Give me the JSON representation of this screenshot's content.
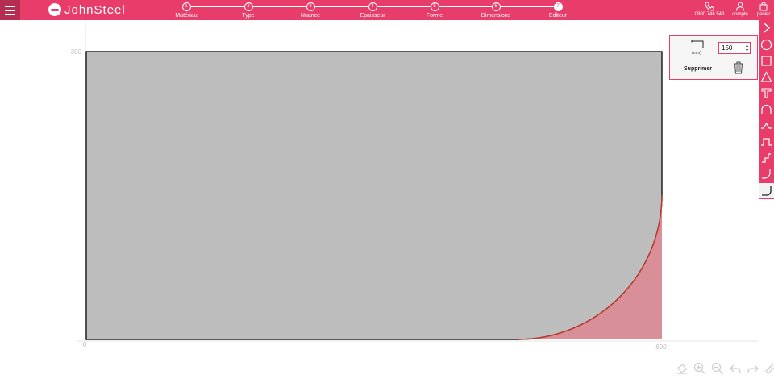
{
  "header": {
    "brand": "JohnSteel",
    "steps": [
      {
        "num": "1",
        "label": "Matériau"
      },
      {
        "num": "2",
        "label": "Type"
      },
      {
        "num": "3",
        "label": "Nuance"
      },
      {
        "num": "4",
        "label": "Epaisseur"
      },
      {
        "num": "5",
        "label": "Forme"
      },
      {
        "num": "6",
        "label": "Dimensions"
      },
      {
        "num": "7",
        "label": "Editeur"
      }
    ],
    "phone": "0800 746 548",
    "account_label": "compte",
    "cart_label": "panier"
  },
  "sidebar_tools": [
    "chevron-right-icon",
    "circle-icon",
    "square-icon",
    "triangle-icon",
    "t-profile-icon",
    "arc-icon",
    "peak-icon",
    "notch-icon",
    "step-icon",
    "step-curve-icon",
    "rounded-corner-icon"
  ],
  "popup": {
    "unit": "(mm)",
    "radius_value": "150",
    "delete_label": "Supprimer"
  },
  "canvas": {
    "axis_labels": {
      "y_top": "300",
      "origin": "0",
      "x_right": "600"
    },
    "colors": {
      "plate_fill": "#bdbdbd",
      "plate_stroke": "#222222",
      "cut_fill": "#d88f98",
      "cut_stroke": "#c0392b",
      "accent": "#e83d6a"
    }
  },
  "bottom_tools": [
    "paint-bucket-icon",
    "zoom-in-icon",
    "zoom-out-icon",
    "undo-icon",
    "redo-icon",
    "ruler-icon"
  ]
}
